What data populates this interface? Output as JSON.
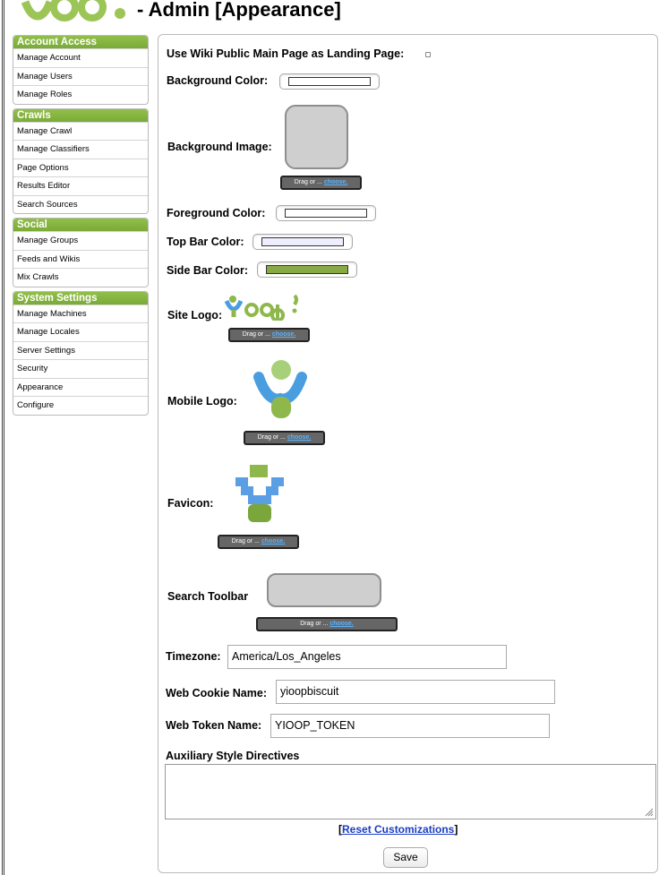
{
  "header": {
    "title": "- Admin [Appearance]"
  },
  "sidebar": {
    "sections": [
      {
        "title": "Account Access",
        "items": [
          "Manage Account",
          "Manage Users",
          "Manage Roles"
        ]
      },
      {
        "title": "Crawls",
        "items": [
          "Manage Crawl",
          "Manage Classifiers",
          "Page Options",
          "Results Editor",
          "Search Sources"
        ]
      },
      {
        "title": "Social",
        "items": [
          "Manage Groups",
          "Feeds and Wikis",
          "Mix Crawls"
        ]
      },
      {
        "title": "System Settings",
        "items": [
          "Manage Machines",
          "Manage Locales",
          "Server Settings",
          "Security",
          "Appearance",
          "Configure"
        ]
      }
    ]
  },
  "form": {
    "wiki_landing_label": "Use Wiki Public Main Page as Landing Page:",
    "background_color_label": "Background Color:",
    "background_color": "#ffffff",
    "background_image_label": "Background Image:",
    "foreground_color_label": "Foreground Color:",
    "foreground_color": "#ffffff",
    "top_bar_color_label": "Top Bar Color:",
    "top_bar_color": "#eeeeff",
    "side_bar_color_label": "Side Bar Color:",
    "side_bar_color": "#88aa44",
    "site_logo_label": "Site Logo:",
    "mobile_logo_label": "Mobile Logo:",
    "favicon_label": "Favicon:",
    "search_toolbar_label": "Search Toolbar",
    "drag_text": "Drag or ...",
    "choose_text": "choose.",
    "timezone_label": "Timezone:",
    "timezone_value": "America/Los_Angeles",
    "cookie_name_label": "Web Cookie Name:",
    "cookie_name_value": "yioopbiscuit",
    "token_name_label": "Web Token Name:",
    "token_name_value": "YIOOP_TOKEN",
    "aux_style_label": "Auxiliary Style Directives",
    "aux_style_value": "",
    "reset_open": "[",
    "reset_link": "Reset Customizations",
    "reset_close": "]",
    "save_label": "Save"
  },
  "colors": {
    "brand_green": "#7aaa38",
    "link_blue": "#1a3dc1",
    "logo_blue": "#4a9ee0",
    "logo_green": "#8fb84c"
  }
}
